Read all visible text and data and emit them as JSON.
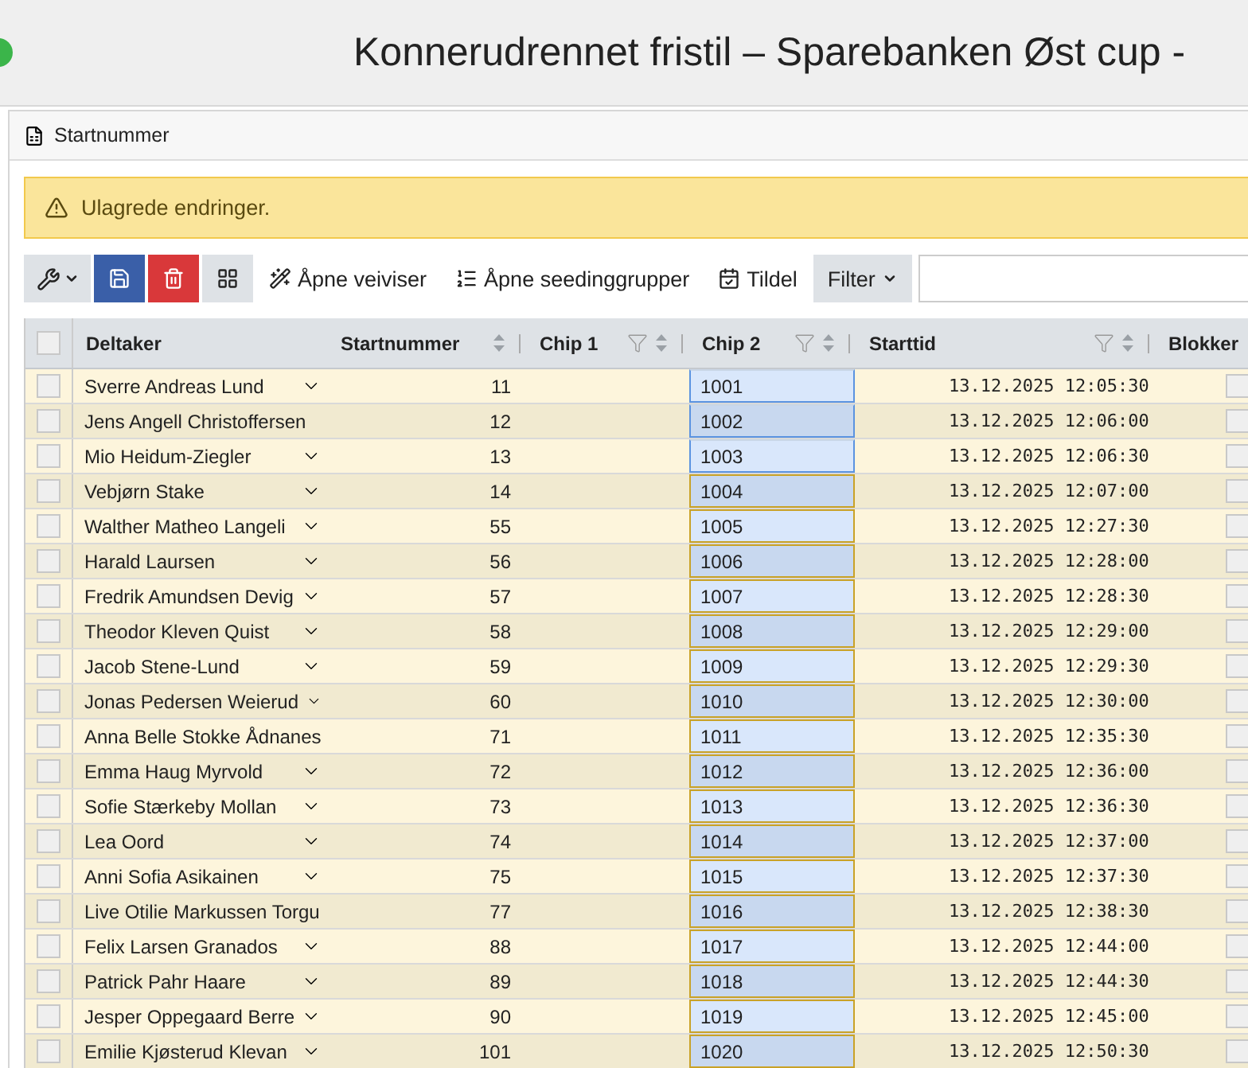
{
  "window": {
    "title": "Konnerudrennet fristil – Sparebanken Øst cup -"
  },
  "panel": {
    "title": "Startnummer"
  },
  "alert": {
    "text": "Ulagrede endringer."
  },
  "toolbar": {
    "icon_buttons": [
      {
        "kind": "tools"
      },
      {
        "kind": "save"
      },
      {
        "kind": "delete"
      },
      {
        "kind": "add"
      }
    ],
    "actions": [
      {
        "kind": "wizard",
        "label": "Åpne veiviser"
      },
      {
        "kind": "groups",
        "label": "Åpne seedinggrupper"
      },
      {
        "kind": "assign",
        "label": "Tildel"
      }
    ],
    "filter": {
      "label": "Filter"
    }
  },
  "table": {
    "all_checked": false,
    "columns": [
      {
        "label": "Deltaker",
        "sortable": false,
        "filterable": false
      },
      {
        "label": "Startnummer",
        "sortable": true,
        "filterable": false
      },
      {
        "label": "Chip 1",
        "sortable": true,
        "filterable": true
      },
      {
        "label": "Chip 2",
        "sortable": true,
        "filterable": true
      },
      {
        "label": "Starttid",
        "sortable": true,
        "filterable": true
      },
      {
        "label": "Blokker",
        "sortable": false,
        "filterable": false
      }
    ],
    "rows": [
      {
        "checked": false,
        "name": "Sverre Andreas Lund",
        "expandable": true,
        "start_number": "11",
        "chip2": "1001",
        "chip2_selected": true,
        "start_time": "13.12.2025 12:05:30",
        "blocked": false
      },
      {
        "checked": false,
        "name": "Jens Angell Christoffersen",
        "expandable": false,
        "start_number": "12",
        "chip2": "1002",
        "chip2_selected": true,
        "start_time": "13.12.2025 12:06:00",
        "blocked": false
      },
      {
        "checked": false,
        "name": "Mio Heidum-Ziegler",
        "expandable": true,
        "start_number": "13",
        "chip2": "1003",
        "chip2_selected": true,
        "start_time": "13.12.2025 12:06:30",
        "blocked": false
      },
      {
        "checked": false,
        "name": "Vebjørn Stake",
        "expandable": true,
        "start_number": "14",
        "chip2": "1004",
        "chip2_selected": false,
        "start_time": "13.12.2025 12:07:00",
        "blocked": false
      },
      {
        "checked": false,
        "name": "Walther Matheo Langeli",
        "expandable": true,
        "start_number": "55",
        "chip2": "1005",
        "chip2_selected": false,
        "start_time": "13.12.2025 12:27:30",
        "blocked": false
      },
      {
        "checked": false,
        "name": "Harald Laursen",
        "expandable": true,
        "start_number": "56",
        "chip2": "1006",
        "chip2_selected": false,
        "start_time": "13.12.2025 12:28:00",
        "blocked": false
      },
      {
        "checked": false,
        "name": "Fredrik Amundsen Devig",
        "expandable": true,
        "start_number": "57",
        "chip2": "1007",
        "chip2_selected": false,
        "start_time": "13.12.2025 12:28:30",
        "blocked": false
      },
      {
        "checked": false,
        "name": "Theodor Kleven Quist",
        "expandable": true,
        "start_number": "58",
        "chip2": "1008",
        "chip2_selected": false,
        "start_time": "13.12.2025 12:29:00",
        "blocked": false
      },
      {
        "checked": false,
        "name": "Jacob Stene-Lund",
        "expandable": true,
        "start_number": "59",
        "chip2": "1009",
        "chip2_selected": false,
        "start_time": "13.12.2025 12:29:30",
        "blocked": false
      },
      {
        "checked": false,
        "name": "Jonas Pedersen Weierud",
        "expandable": true,
        "start_number": "60",
        "chip2": "1010",
        "chip2_selected": false,
        "start_time": "13.12.2025 12:30:00",
        "blocked": false
      },
      {
        "checked": false,
        "name": "Anna Belle Stokke Ådnanes",
        "expandable": false,
        "start_number": "71",
        "chip2": "1011",
        "chip2_selected": false,
        "start_time": "13.12.2025 12:35:30",
        "blocked": false
      },
      {
        "checked": false,
        "name": "Emma Haug Myrvold",
        "expandable": true,
        "start_number": "72",
        "chip2": "1012",
        "chip2_selected": false,
        "start_time": "13.12.2025 12:36:00",
        "blocked": false
      },
      {
        "checked": false,
        "name": "Sofie Stærkeby Mollan",
        "expandable": true,
        "start_number": "73",
        "chip2": "1013",
        "chip2_selected": false,
        "start_time": "13.12.2025 12:36:30",
        "blocked": false
      },
      {
        "checked": false,
        "name": "Lea Oord",
        "expandable": true,
        "start_number": "74",
        "chip2": "1014",
        "chip2_selected": false,
        "start_time": "13.12.2025 12:37:00",
        "blocked": false
      },
      {
        "checked": false,
        "name": "Anni Sofia Asikainen",
        "expandable": true,
        "start_number": "75",
        "chip2": "1015",
        "chip2_selected": false,
        "start_time": "13.12.2025 12:37:30",
        "blocked": false
      },
      {
        "checked": false,
        "name": "Live Otilie Markussen Torgu",
        "expandable": false,
        "start_number": "77",
        "chip2": "1016",
        "chip2_selected": false,
        "start_time": "13.12.2025 12:38:30",
        "blocked": false
      },
      {
        "checked": false,
        "name": "Felix Larsen Granados",
        "expandable": true,
        "start_number": "88",
        "chip2": "1017",
        "chip2_selected": false,
        "start_time": "13.12.2025 12:44:00",
        "blocked": false
      },
      {
        "checked": false,
        "name": "Patrick Pahr Haare",
        "expandable": true,
        "start_number": "89",
        "chip2": "1018",
        "chip2_selected": false,
        "start_time": "13.12.2025 12:44:30",
        "blocked": false
      },
      {
        "checked": false,
        "name": "Jesper Oppegaard Berre",
        "expandable": true,
        "start_number": "90",
        "chip2": "1019",
        "chip2_selected": false,
        "start_time": "13.12.2025 12:45:00",
        "blocked": false
      },
      {
        "checked": false,
        "name": "Emilie Kjøsterud Klevan",
        "expandable": true,
        "start_number": "101",
        "chip2": "1020",
        "chip2_selected": false,
        "start_time": "13.12.2025 12:50:30",
        "blocked": false
      }
    ]
  }
}
